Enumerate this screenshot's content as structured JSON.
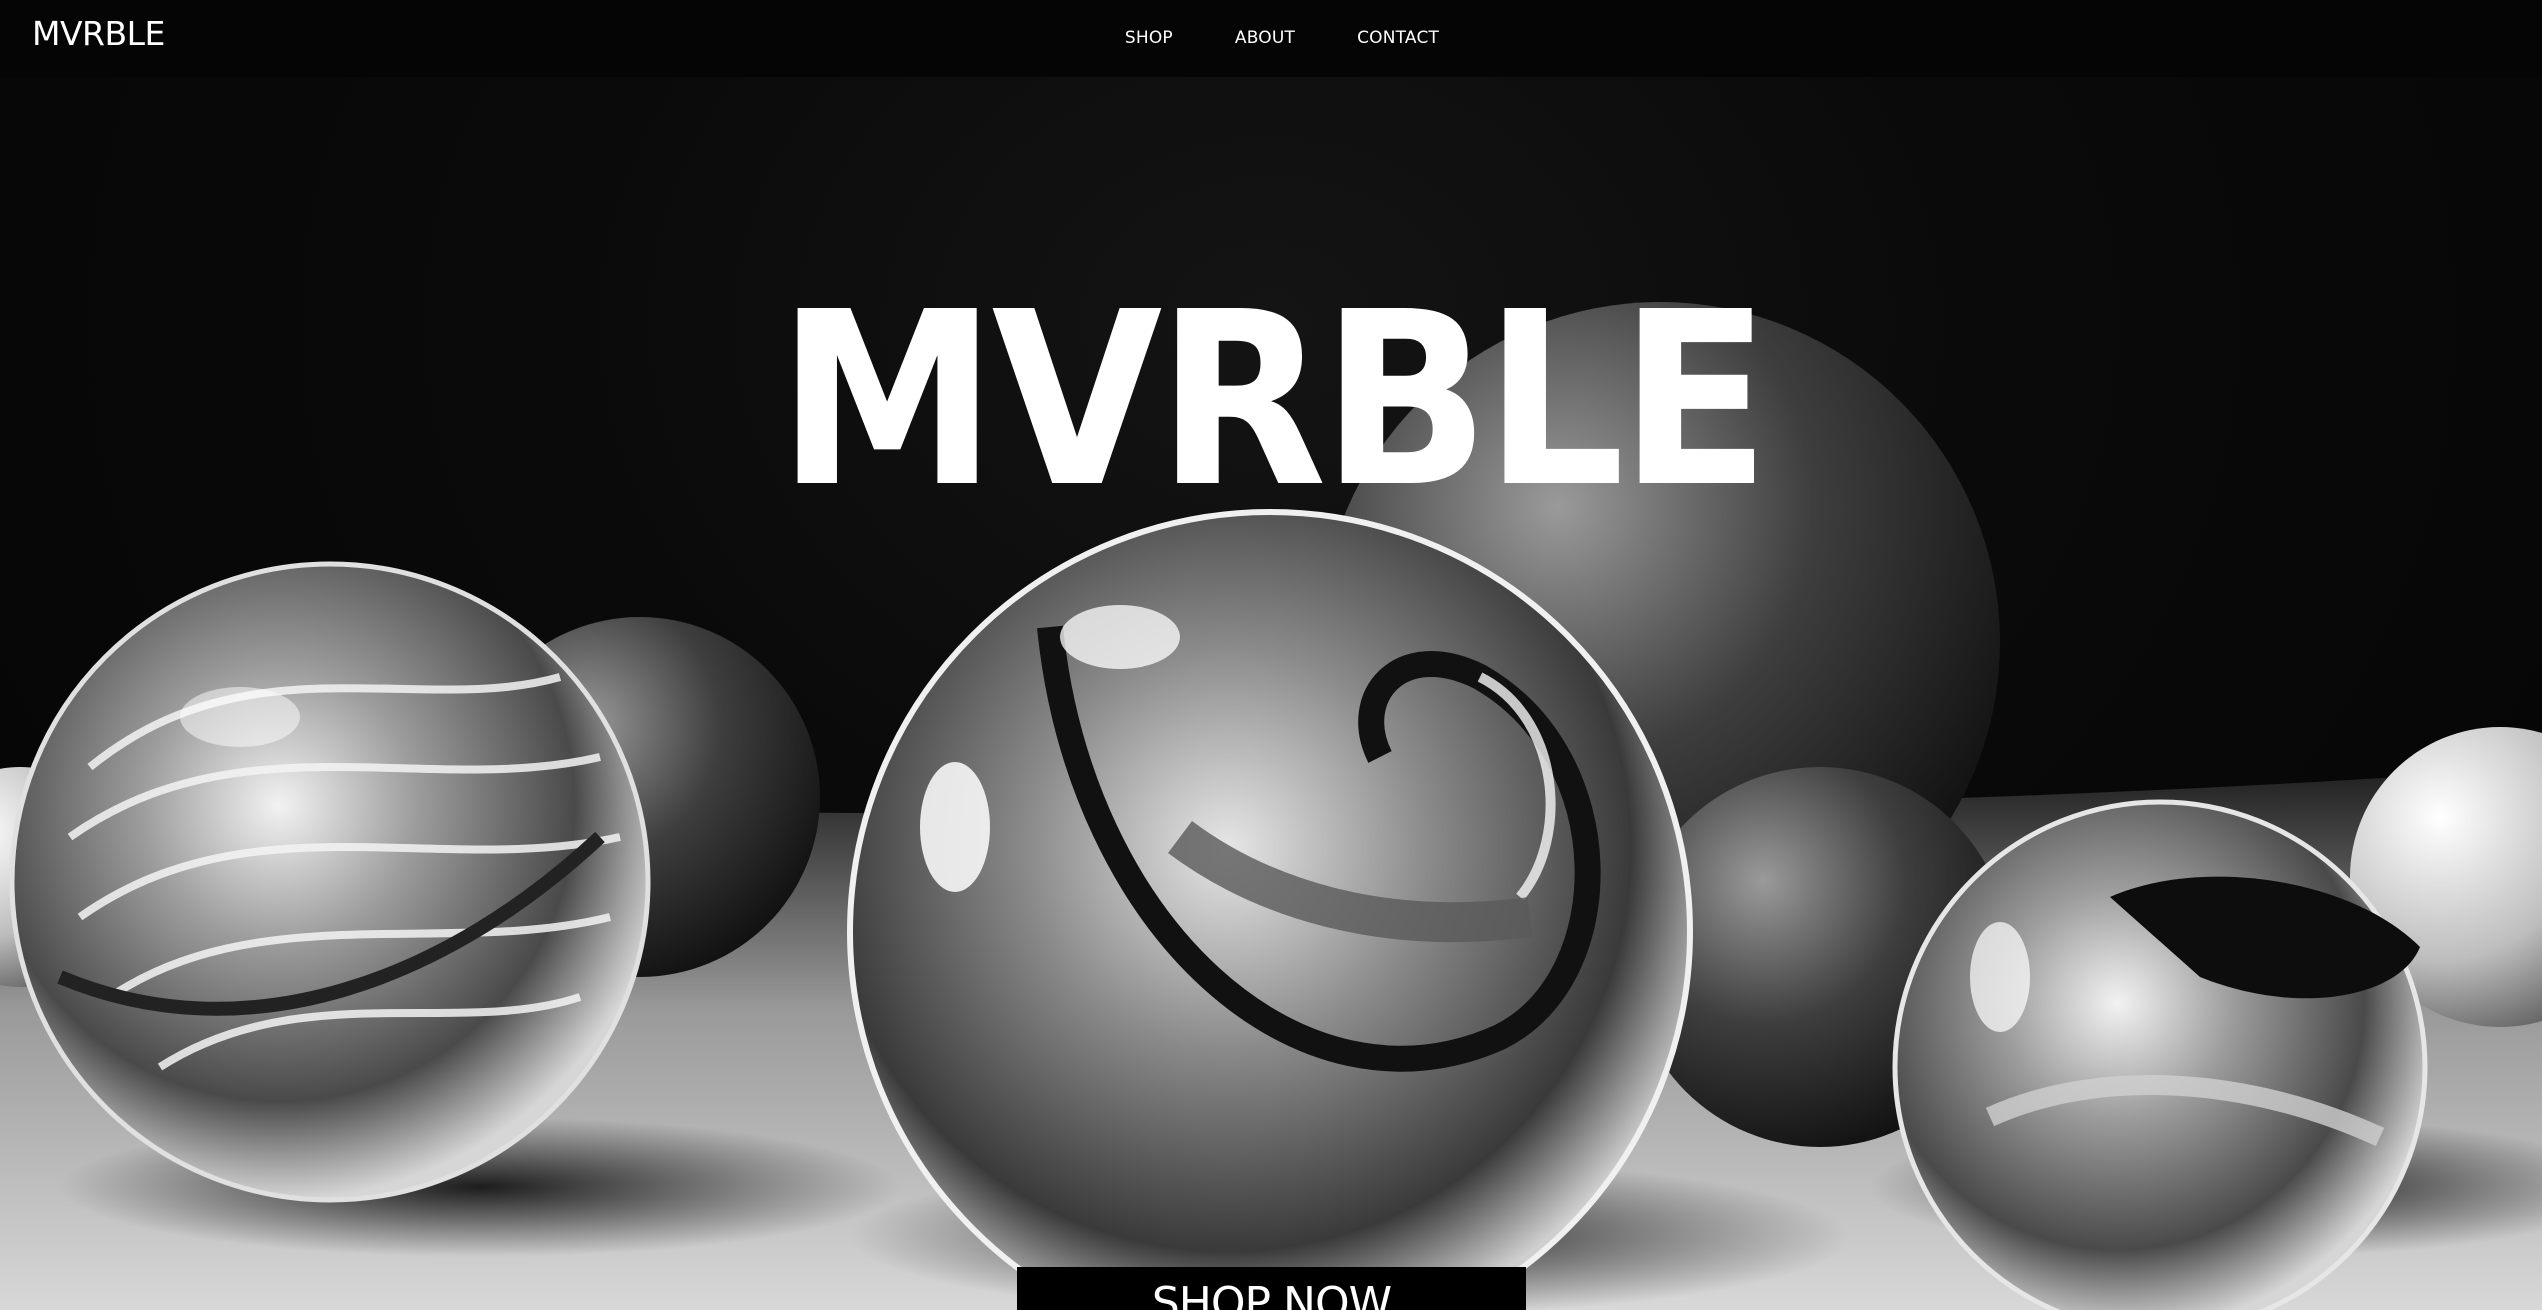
{
  "brand": {
    "logo_text": "MVRBLE"
  },
  "nav": {
    "items": [
      {
        "label": "SHOP"
      },
      {
        "label": "ABOUT"
      },
      {
        "label": "CONTACT"
      }
    ]
  },
  "hero": {
    "title": "MVRBLE",
    "cta_label": "SHOP NOW",
    "image_subject": "black-and-white glass marbles"
  },
  "colors": {
    "background": "#050505",
    "text": "#ffffff",
    "button_bg": "#000000"
  }
}
